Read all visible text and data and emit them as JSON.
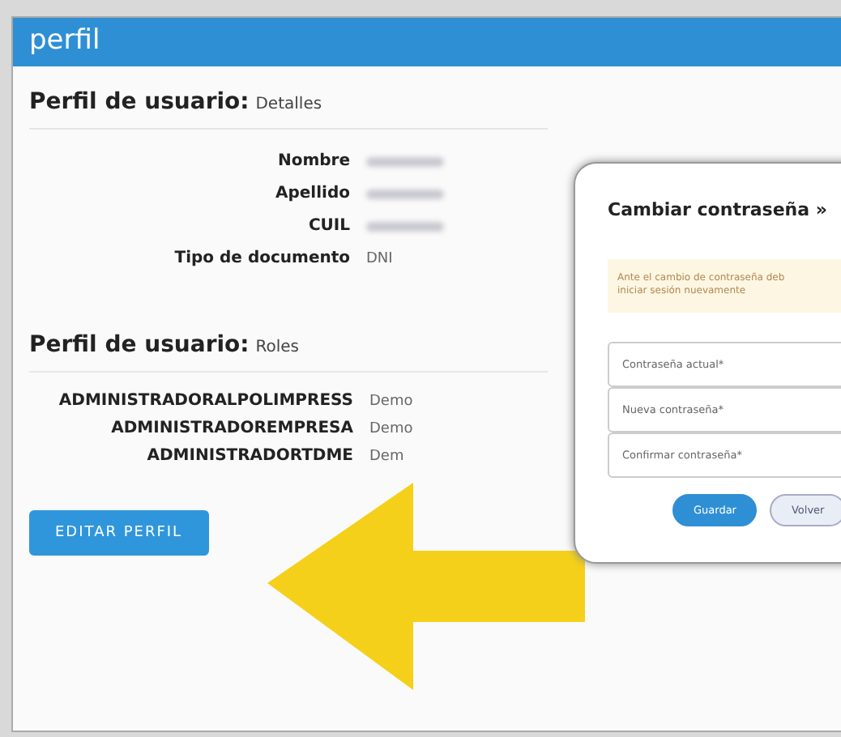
{
  "window": {
    "title": "perfil"
  },
  "details": {
    "heading": "Perfil de usuario:",
    "subheading": "Detalles",
    "fields": [
      {
        "label": "Nombre"
      },
      {
        "label": "Apellido"
      },
      {
        "label": "CUIL"
      },
      {
        "label": "Tipo de documento",
        "value": "DNI"
      }
    ]
  },
  "roles": {
    "heading": "Perfil de usuario:",
    "subheading": "Roles",
    "items": [
      {
        "name": "ADMINISTRADORALPOLIMPRESS",
        "value": "Demo"
      },
      {
        "name": "ADMINISTRADOREMPRESA",
        "value": "Demo"
      },
      {
        "name": "ADMINISTRADORTDME",
        "value": "Dem"
      }
    ]
  },
  "edit_button": "EDITAR PERFIL",
  "modal": {
    "title": "Cambiar contraseña »",
    "notice_lines": [
      "Ante el cambio de contraseña deb",
      "iniciar sesión nuevamente"
    ],
    "fields": [
      {
        "placeholder": "Contraseña actual*"
      },
      {
        "placeholder": "Nueva contraseña*"
      },
      {
        "placeholder": "Confirmar contraseña*"
      }
    ],
    "buttons": [
      {
        "label": "Guardar",
        "kind": "primary"
      },
      {
        "label": "Volver",
        "kind": "secondary"
      }
    ]
  }
}
